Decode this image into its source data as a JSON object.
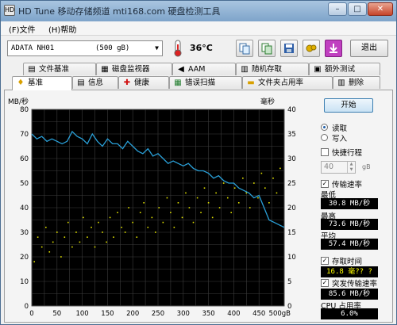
{
  "window": {
    "title": "HD Tune 移动存储频道 mti168.com 硬盘检测工具",
    "app_icon": "HD",
    "minimize": "–",
    "maximize": "□",
    "close": "✕"
  },
  "menu": [
    "(F)文件",
    "(H)帮助"
  ],
  "toolbar": {
    "drive_name": "ADATA  NH01",
    "drive_size": "(500 gB)",
    "temperature": "36°C",
    "exit_label": "退出",
    "icons": [
      "copy-text-icon",
      "copy-screenshot-icon",
      "save-icon",
      "options-icon",
      "download-icon"
    ]
  },
  "tabs_back": [
    {
      "label": "文件基准",
      "icon": "file-benchmark-icon"
    },
    {
      "label": "磁盘监视器",
      "icon": "disk-monitor-icon"
    },
    {
      "label": "AAM",
      "icon": "speaker-icon"
    },
    {
      "label": "随机存取",
      "icon": "random-access-icon"
    },
    {
      "label": "额外测试",
      "icon": "extra-tests-icon"
    }
  ],
  "tabs_front": [
    {
      "label": "基准",
      "icon": "benchmark-icon"
    },
    {
      "label": "信息",
      "icon": "info-icon"
    },
    {
      "label": "健康",
      "icon": "health-icon"
    },
    {
      "label": "错误扫描",
      "icon": "error-scan-icon"
    },
    {
      "label": "文件夹占用率",
      "icon": "folder-usage-icon"
    },
    {
      "label": "删除",
      "icon": "erase-icon"
    }
  ],
  "side": {
    "start_label": "开始",
    "read_label": "读取",
    "write_label": "写入",
    "shortstroke_label": "快捷行程",
    "shortstroke_value": "40",
    "shortstroke_unit": "gB",
    "transfer_rate_label": "传输速率",
    "min_label": "最低",
    "min_value": "30.8 MB/秒",
    "max_label": "最高",
    "max_value": "73.6 MB/秒",
    "avg_label": "平均",
    "avg_value": "57.4 MB/秒",
    "access_time_label": "存取时间",
    "access_time_value": "16.8 毫?? ?",
    "burst_rate_label": "突发传输速率",
    "burst_rate_value": "85.6 MB/秒",
    "cpu_label": "CPU 占用率",
    "cpu_value": "6.0%"
  },
  "chart_data": {
    "type": "line",
    "ylabel_left": "MB/秒",
    "ylabel_right": "毫秒",
    "x_ticks": [
      "0",
      "50",
      "100",
      "150",
      "200",
      "250",
      "300",
      "350",
      "400",
      "450",
      "500gB"
    ],
    "y_left_ticks": [
      "0",
      "10",
      "20",
      "30",
      "40",
      "50",
      "60",
      "70",
      "80"
    ],
    "y_right_ticks": [
      "0",
      "5",
      "10",
      "15",
      "20",
      "25",
      "30",
      "35",
      "40"
    ],
    "xlim": [
      0,
      500
    ],
    "ylim_left": [
      0,
      80
    ],
    "ylim_right": [
      0,
      40
    ],
    "grid": true,
    "series": [
      {
        "color": "#2aa0d8",
        "x": [
          0,
          10,
          20,
          30,
          40,
          50,
          60,
          70,
          80,
          90,
          100,
          110,
          120,
          130,
          140,
          150,
          160,
          170,
          180,
          190,
          200,
          210,
          220,
          230,
          240,
          250,
          260,
          270,
          280,
          290,
          300,
          310,
          320,
          330,
          340,
          350,
          360,
          370,
          380,
          390,
          400,
          410,
          420,
          430,
          440,
          450,
          460,
          470,
          480,
          490,
          500
        ],
        "y": [
          70,
          68,
          69,
          67,
          68,
          67,
          66,
          67,
          71,
          69,
          68,
          66,
          70,
          67,
          65,
          68,
          66,
          66,
          64,
          67,
          65,
          63,
          62,
          64,
          61,
          62,
          60,
          58,
          59,
          58,
          57,
          58,
          56,
          55,
          55,
          54,
          52,
          53,
          51,
          50,
          50,
          48,
          47,
          46,
          44,
          45,
          40,
          35,
          34,
          33,
          32
        ]
      },
      {
        "color": "#e0e000",
        "type": "scatter",
        "description_y": "access time (ms, right axis)",
        "x": [
          5,
          12,
          20,
          28,
          35,
          42,
          50,
          58,
          65,
          72,
          80,
          88,
          95,
          102,
          110,
          118,
          125,
          132,
          140,
          148,
          155,
          162,
          170,
          178,
          185,
          192,
          200,
          208,
          215,
          222,
          230,
          238,
          245,
          252,
          260,
          268,
          275,
          282,
          290,
          298,
          305,
          312,
          320,
          328,
          335,
          342,
          350,
          358,
          365,
          372,
          380,
          388,
          395,
          402,
          410,
          418,
          425,
          432,
          440,
          448,
          455,
          462,
          470,
          478,
          485,
          492
        ],
        "y": [
          9,
          14,
          12,
          16,
          11,
          13,
          15,
          10,
          14,
          17,
          12,
          15,
          13,
          18,
          14,
          16,
          12,
          17,
          15,
          13,
          18,
          14,
          19,
          16,
          15,
          20,
          17,
          14,
          19,
          21,
          16,
          18,
          15,
          20,
          17,
          22,
          19,
          16,
          21,
          18,
          23,
          20,
          17,
          22,
          19,
          24,
          21,
          18,
          23,
          20,
          25,
          22,
          19,
          24,
          21,
          26,
          23,
          20,
          25,
          22,
          27,
          24,
          21,
          26,
          23,
          28
        ]
      }
    ]
  }
}
